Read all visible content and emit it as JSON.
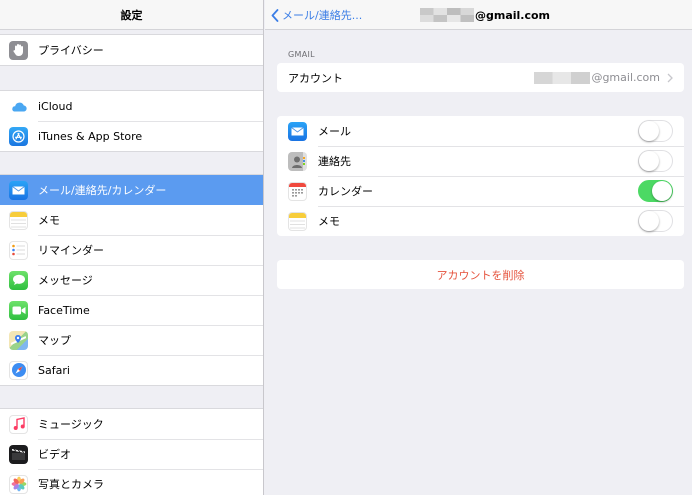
{
  "left": {
    "title": "設定",
    "groups": [
      {
        "items": [
          {
            "label": "プライバシー",
            "icon": "privacy-hand-icon"
          }
        ]
      },
      {
        "items": [
          {
            "label": "iCloud",
            "icon": "icloud-icon"
          },
          {
            "label": "iTunes & App Store",
            "icon": "app-store-icon"
          }
        ]
      },
      {
        "items": [
          {
            "label": "メール/連絡先/カレンダー",
            "icon": "mail-icon",
            "selected": true
          },
          {
            "label": "メモ",
            "icon": "notes-icon"
          },
          {
            "label": "リマインダー",
            "icon": "reminders-icon"
          },
          {
            "label": "メッセージ",
            "icon": "messages-icon"
          },
          {
            "label": "FaceTime",
            "icon": "facetime-icon"
          },
          {
            "label": "マップ",
            "icon": "maps-icon"
          },
          {
            "label": "Safari",
            "icon": "safari-icon"
          }
        ]
      },
      {
        "items": [
          {
            "label": "ミュージック",
            "icon": "music-icon"
          },
          {
            "label": "ビデオ",
            "icon": "videos-icon"
          },
          {
            "label": "写真とカメラ",
            "icon": "photos-icon"
          }
        ]
      }
    ]
  },
  "right": {
    "back_label": "メール/連絡先...",
    "title_suffix": "@gmail.com",
    "section_label": "GMAIL",
    "account": {
      "label": "アカウント",
      "value_suffix": "@gmail.com"
    },
    "services": [
      {
        "label": "メール",
        "icon": "mail-icon",
        "on": false
      },
      {
        "label": "連絡先",
        "icon": "contacts-icon",
        "on": false
      },
      {
        "label": "カレンダー",
        "icon": "calendar-icon",
        "on": true
      },
      {
        "label": "メモ",
        "icon": "notes-icon",
        "on": false
      }
    ],
    "delete_label": "アカウントを削除"
  },
  "colors": {
    "accent": "#3b7ee6",
    "selected_row": "#5b9bf0",
    "toggle_on": "#4cd964",
    "destructive": "#e5533d"
  }
}
